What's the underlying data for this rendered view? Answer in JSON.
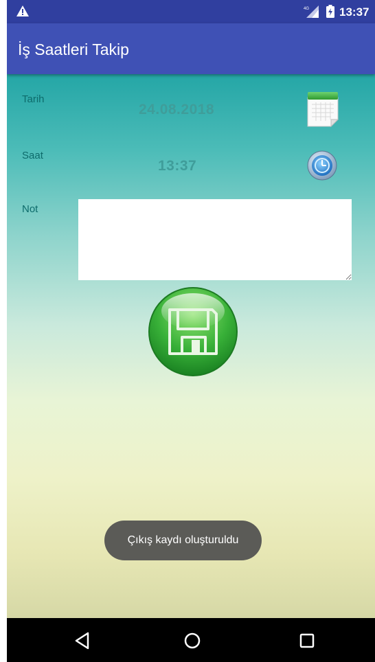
{
  "status_bar": {
    "time": "13:37",
    "network": "4G",
    "icons": [
      "warning-icon",
      "signal-icon",
      "battery-icon"
    ]
  },
  "app_bar": {
    "title": "İş Saatleri Takip",
    "color": "#3F51B5"
  },
  "form": {
    "date_label": "Tarih",
    "date_value": "24.08.2018",
    "time_label": "Saat",
    "time_value": "13:37",
    "note_label": "Not",
    "note_value": "",
    "icons": {
      "date_picker": "calendar-icon",
      "time_picker": "clock-icon",
      "save": "floppy-disk-icon"
    }
  },
  "toast": {
    "message": "Çıkış kaydı oluşturuldu"
  },
  "nav_bar": {
    "buttons": [
      "back",
      "home",
      "recents"
    ]
  },
  "colors": {
    "status_bar": "#303F9F",
    "label_text": "#0d6b6b",
    "value_text": "#3f9d9a",
    "save_button": "#2e9e2e",
    "toast_bg": "#5b5b57"
  }
}
